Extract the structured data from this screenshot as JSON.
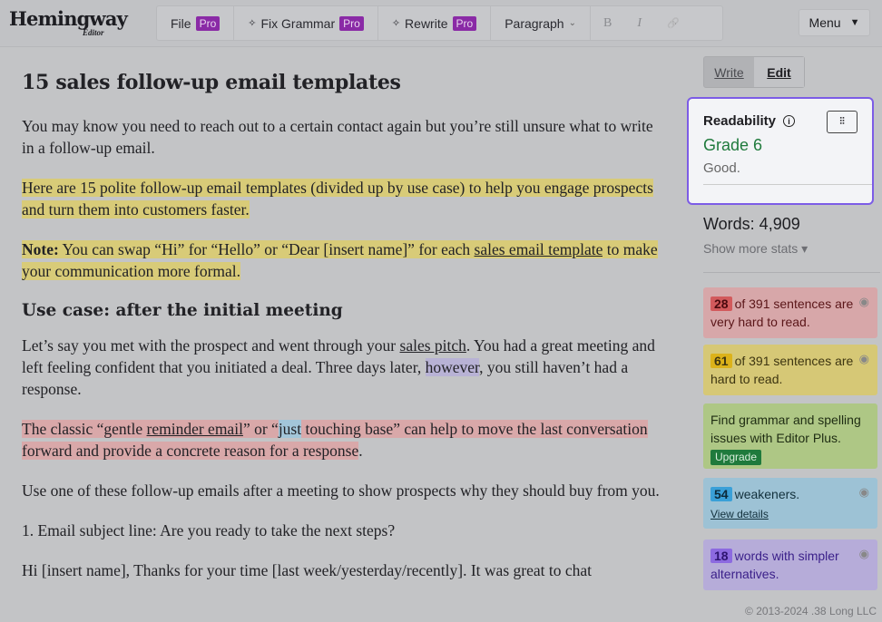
{
  "header": {
    "logo": "Hemingway",
    "logo_sub": "Editor",
    "file": "File",
    "fix_grammar": "Fix Grammar",
    "rewrite": "Rewrite",
    "pro": "Pro",
    "paragraph": "Paragraph",
    "bold": "B",
    "italic": "I",
    "link": "🔗",
    "menu": "Menu"
  },
  "main": {
    "title": "15 sales follow-up email templates",
    "paragraphs": [
      [
        {
          "t": "You may know you need to reach out to a certain contact again but you’re still unsure what to write in a follow-up email."
        }
      ],
      [
        {
          "t": "Here are 15 polite follow-up email templates (divided up by use case) to help you engage prospects and turn them into customers faster.",
          "hl": "yellow"
        }
      ],
      [
        {
          "t": "Note:",
          "hl": "yellow",
          "b": true
        },
        {
          "t": " You can swap “Hi” for “Hello” or “Dear [insert name]” for each ",
          "hl": "yellow"
        },
        {
          "t": "sales email template",
          "hl": "yellow",
          "link": true
        },
        {
          "t": " to make your communication more formal.",
          "hl": "yellow"
        }
      ],
      {
        "heading": "Use case: after the initial meeting"
      },
      [
        {
          "t": "Let’s say you met with the prospect and went through your "
        },
        {
          "t": "sales pitch",
          "link": true
        },
        {
          "t": ". You had a great meeting and left feeling confident that you initiated a deal. Three days later, "
        },
        {
          "t": "however",
          "hl": "purple"
        },
        {
          "t": ", you still haven’t had a response."
        }
      ],
      [
        {
          "t": "The classic “gentle ",
          "hl": "red"
        },
        {
          "t": "reminder email",
          "hl": "red",
          "link": true
        },
        {
          "t": "” or “",
          "hl": "red"
        },
        {
          "t": "just",
          "hl": "blue"
        },
        {
          "t": " touching base” can help to move the last conversation forward and provide a concrete reason for a response",
          "hl": "red"
        },
        {
          "t": "."
        }
      ],
      [
        {
          "t": "Use one of these follow-up emails after a meeting to show prospects why they should buy from you."
        }
      ],
      [
        {
          "t": "1. Email subject line: Are you ready to take the next steps?"
        }
      ],
      [
        {
          "t": "Hi [insert name], Thanks for your time [last week/yesterday/recently]. It was great to chat"
        }
      ]
    ]
  },
  "sidebar": {
    "write": "Write",
    "edit": "Edit",
    "readability": "Readability",
    "grade": "Grade 6",
    "grade_desc": "Good.",
    "words": "Words: 4,909",
    "more_stats": "Show more stats ▾",
    "very_hard": {
      "count": "28",
      "text": "of 391 sentences are very hard to read."
    },
    "hard": {
      "count": "61",
      "text": "of 391 sentences are hard to read."
    },
    "grammar": {
      "text": "Find grammar and spelling issues with Editor Plus.",
      "button": "Upgrade"
    },
    "weakeners": {
      "count": "54",
      "text": "weakeners.",
      "link": "View details"
    },
    "simpler": {
      "count": "18",
      "text": "words with simpler alternatives."
    },
    "copyright": "© 2013-2024 .38 Long LLC"
  }
}
